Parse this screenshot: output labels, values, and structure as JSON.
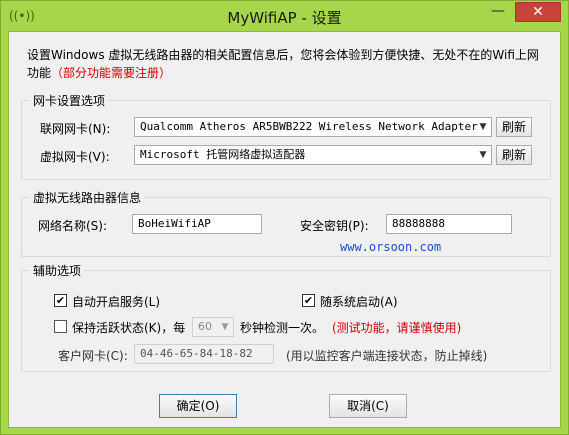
{
  "window": {
    "title": "MyWifiAP - 设置",
    "minimize_glyph": "—",
    "close_glyph": "✕"
  },
  "description": {
    "text": "设置Windows 虚拟无线路由器的相关配置信息后，您将会体验到方便快捷、无处不在的Wifi上网功能",
    "note": "（部分功能需要注册）"
  },
  "network_card": {
    "group_title": "网卡设置选项",
    "internet_label": "联网网卡(N):",
    "internet_value": "Qualcomm Atheros AR5BWB222 Wireless Network Adapter",
    "virtual_label": "虚拟网卡(V):",
    "virtual_value": "Microsoft 托管网络虚拟适配器",
    "refresh_label": "刷新"
  },
  "router_info": {
    "group_title": "虚拟无线路由器信息",
    "ssid_label": "网络名称(S):",
    "ssid_value": "BoHeiWifiAP",
    "key_label": "安全密钥(P):",
    "key_value": "88888888",
    "watermark": "www.orsoon.com"
  },
  "options": {
    "group_title": "辅助选项",
    "auto_start_label": "自动开启服务(L)",
    "auto_start_checked": true,
    "boot_start_label": "随系统启动(A)",
    "boot_start_checked": true,
    "keep_alive_label": "保持活跃状态(K)，每",
    "keep_alive_checked": false,
    "interval_value": "60",
    "interval_suffix": "秒钟检测一次。",
    "interval_note": "(测试功能，请谨慎使用)",
    "client_nic_label": "客户网卡(C):",
    "client_nic_value": "04-46-65-84-18-82",
    "client_nic_note": "(用以监控客户端连接状态，防止掉线)"
  },
  "buttons": {
    "ok_label": "确定(O)",
    "cancel_label": "取消(C)"
  },
  "icons": {
    "app": "wifi-signal-icon",
    "check": "✔",
    "dropdown": "▼"
  },
  "colors": {
    "frame": "#a7d64a",
    "accent_red": "#d00000",
    "link_blue": "#1a4fd0"
  }
}
